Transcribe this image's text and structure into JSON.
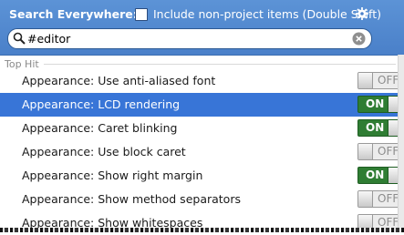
{
  "header": {
    "title": "Search Everywhere:",
    "include_label": "Include non-project items (Double Shift)",
    "include_checked": false,
    "settings_icon": "gear-icon"
  },
  "search": {
    "value": "#editor",
    "search_icon": "search-icon",
    "clear_icon": "clear-icon"
  },
  "group": {
    "label": "Top Hit"
  },
  "results": [
    {
      "label": "Appearance: Use anti-aliased font",
      "state": "OFF",
      "selected": false
    },
    {
      "label": "Appearance: LCD rendering",
      "state": "ON",
      "selected": true
    },
    {
      "label": "Appearance: Caret blinking",
      "state": "ON",
      "selected": false
    },
    {
      "label": "Appearance: Use block caret",
      "state": "OFF",
      "selected": false
    },
    {
      "label": "Appearance: Show right margin",
      "state": "ON",
      "selected": false
    },
    {
      "label": "Appearance: Show method separators",
      "state": "OFF",
      "selected": false
    },
    {
      "label": "Appearance: Show whitespaces",
      "state": "OFF",
      "selected": false
    }
  ],
  "colors": {
    "header": "#4a80c9",
    "selection": "#3875d7",
    "toggle_on": "#2f7d33"
  }
}
